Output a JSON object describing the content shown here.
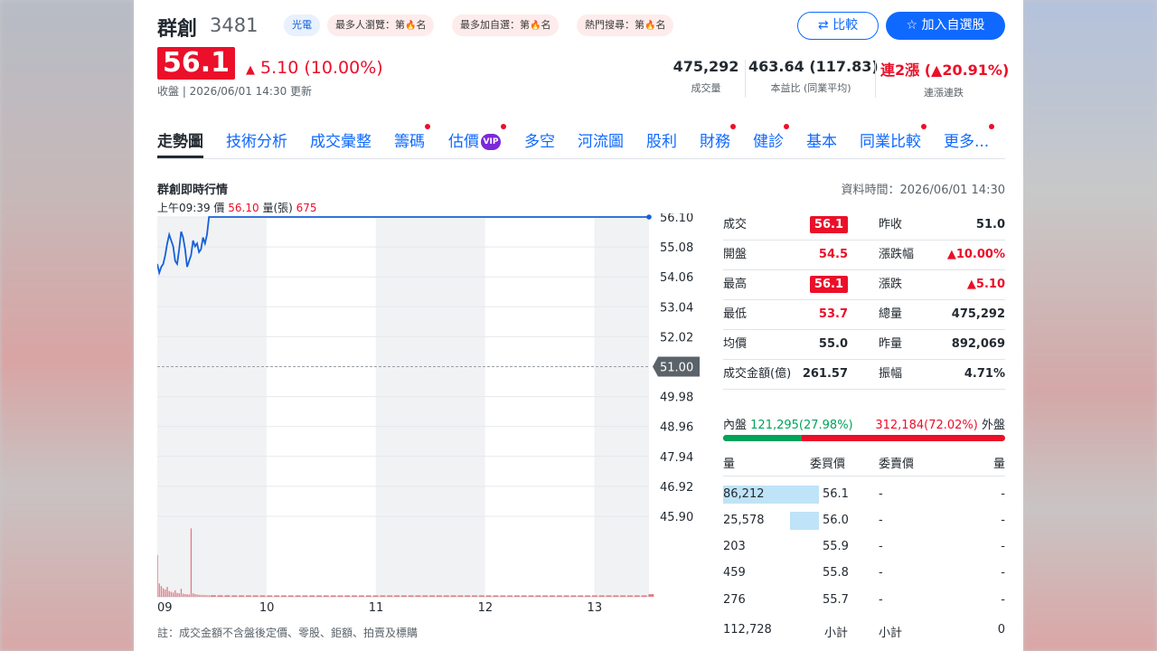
{
  "header": {
    "name": "群創",
    "code": "3481",
    "sector_tag": "光電",
    "rank_tags": [
      {
        "prefix": "最多人瀏覽：第",
        "suffix": "名"
      },
      {
        "prefix": "最多加自選：第",
        "suffix": "名"
      },
      {
        "prefix": "熱門搜尋：第",
        "suffix": "名"
      }
    ],
    "compare_label": "比較",
    "add_watchlist_label": "加入自選股"
  },
  "quote": {
    "price": "56.1",
    "change": "5.10 (10.00%)",
    "close_info": "收盤 | 2026/06/01 14:30 更新",
    "volume_value": "475,292",
    "volume_label": "成交量",
    "pe_value": "463.64 (117.83)",
    "pe_label": "本益比 (同業平均)",
    "streak_value": "連2漲 (▲20.91%)",
    "streak_label": "連漲連跌"
  },
  "tabs": [
    "走勢圖",
    "技術分析",
    "成交彙整",
    "籌碼",
    "估價",
    "多空",
    "河流圖",
    "股利",
    "財務",
    "健診",
    "基本",
    "同業比較",
    "更多..."
  ],
  "vip_label": "VIP",
  "chart_section": {
    "title": "群創即時行情",
    "data_time": "資料時間：2026/06/01 14:30",
    "hover_time": "上午09:39",
    "hover_price_label": "價",
    "hover_price": "56.10",
    "hover_vol_label": "量(張)",
    "hover_vol": "675",
    "footnote": "註：成交金額不含盤後定價、零股、鉅額、拍賣及標購"
  },
  "chart_data": {
    "type": "line",
    "x_ticks": [
      "09",
      "10",
      "11",
      "12",
      "13"
    ],
    "y_ticks": [
      "56.10",
      "55.08",
      "54.06",
      "53.04",
      "52.02",
      "51.00",
      "49.98",
      "48.96",
      "47.94",
      "46.92",
      "45.90"
    ],
    "ylim": [
      45.9,
      56.1
    ],
    "reference_price": 51.0,
    "series": [
      {
        "values": [
          54.5,
          54.2,
          54.4,
          54.5,
          54.8,
          55.2,
          55.5,
          55.3,
          55.1,
          54.6,
          54.5,
          55.0,
          55.6,
          55.4,
          55.0,
          54.4,
          54.6,
          54.8,
          55.3,
          55.1,
          55.2,
          54.9,
          55.0,
          55.4,
          55.2,
          55.5,
          56.1,
          56.1,
          56.1,
          56.1,
          56.1,
          56.1,
          56.1,
          56.1,
          56.1,
          56.1,
          56.1,
          56.1,
          56.1,
          56.1,
          56.1,
          56.1,
          56.1,
          56.1,
          56.1,
          56.1,
          56.1,
          56.1,
          56.1,
          56.1,
          56.1,
          56.1,
          56.1,
          56.1,
          56.1,
          56.1,
          56.1,
          56.1,
          56.1,
          56.1,
          56.1,
          56.1,
          56.1,
          56.1,
          56.1,
          56.1,
          56.1,
          56.1,
          56.1,
          56.1,
          56.1,
          56.1,
          56.1,
          56.1,
          56.1,
          56.1,
          56.1,
          56.1,
          56.1,
          56.1,
          56.1,
          56.1,
          56.1,
          56.1,
          56.1,
          56.1,
          56.1,
          56.1,
          56.1,
          56.1
        ]
      }
    ],
    "volume": [
      11000,
      3500,
      2800,
      2200,
      1900,
      2600,
      1500,
      1300,
      1100,
      1700,
      1000,
      900,
      2100,
      800,
      700,
      650,
      600,
      18000,
      900,
      700,
      600,
      500,
      500,
      450,
      450,
      400,
      400,
      400,
      380,
      380,
      360,
      360,
      350,
      350,
      340,
      340,
      330,
      330,
      330,
      320,
      320,
      320,
      310,
      310,
      310,
      300,
      300,
      300,
      300,
      300,
      300,
      300,
      300,
      300,
      300,
      300,
      300,
      300,
      300,
      300,
      300,
      300,
      300,
      300,
      300,
      300,
      300,
      300,
      300,
      300,
      300,
      300,
      300,
      300,
      300,
      300,
      300,
      300,
      300,
      300,
      300,
      300,
      300,
      300,
      300,
      300,
      300,
      300,
      300,
      675
    ],
    "grid": true
  },
  "quote_table": [
    {
      "l_label": "成交",
      "l_value": "56.1",
      "l_style": "box",
      "r_label": "昨收",
      "r_value": "51.0",
      "r_style": "plain"
    },
    {
      "l_label": "開盤",
      "l_value": "54.5",
      "l_style": "red",
      "r_label": "漲跌幅",
      "r_value": "▲10.00%",
      "r_style": "red"
    },
    {
      "l_label": "最高",
      "l_value": "56.1",
      "l_style": "box",
      "r_label": "漲跌",
      "r_value": "▲5.10",
      "r_style": "red"
    },
    {
      "l_label": "最低",
      "l_value": "53.7",
      "l_style": "red",
      "r_label": "總量",
      "r_value": "475,292",
      "r_style": "plain"
    },
    {
      "l_label": "均價",
      "l_value": "55.0",
      "l_style": "plain",
      "r_label": "昨量",
      "r_value": "892,069",
      "r_style": "plain"
    },
    {
      "l_label": "成交金額(億)",
      "l_value": "261.57",
      "l_style": "plain",
      "r_label": "振幅",
      "r_value": "4.71%",
      "r_style": "plain"
    }
  ],
  "inner_outer": {
    "inner_label": "內盤",
    "inner_value": "121,295(27.98%)",
    "outer_value": "312,184(72.02%)",
    "outer_label": "外盤",
    "inner_ratio": 0.2798
  },
  "order_book": {
    "headers": {
      "bid_vol": "量",
      "bid_price": "委買價",
      "ask_price": "委賣價",
      "ask_vol": "量"
    },
    "rows": [
      {
        "bid_vol": "86,212",
        "bid_price": "56.1",
        "ask_price": "-",
        "ask_vol": "-",
        "ratio": 1.0
      },
      {
        "bid_vol": "25,578",
        "bid_price": "56.0",
        "ask_price": "-",
        "ask_vol": "-",
        "ratio": 0.3
      },
      {
        "bid_vol": "203",
        "bid_price": "55.9",
        "ask_price": "-",
        "ask_vol": "-",
        "ratio": 0.0
      },
      {
        "bid_vol": "459",
        "bid_price": "55.8",
        "ask_price": "-",
        "ask_vol": "-",
        "ratio": 0.0
      },
      {
        "bid_vol": "276",
        "bid_price": "55.7",
        "ask_price": "-",
        "ask_vol": "-",
        "ratio": 0.0
      }
    ],
    "bid_total": "112,728",
    "subtotal_label": "小計",
    "ask_subtotal_label": "小計",
    "ask_total": "0"
  },
  "colors": {
    "up": "#eb0f29",
    "down": "#00a35a",
    "accent": "#0f69ff",
    "line": "#1560d8"
  }
}
